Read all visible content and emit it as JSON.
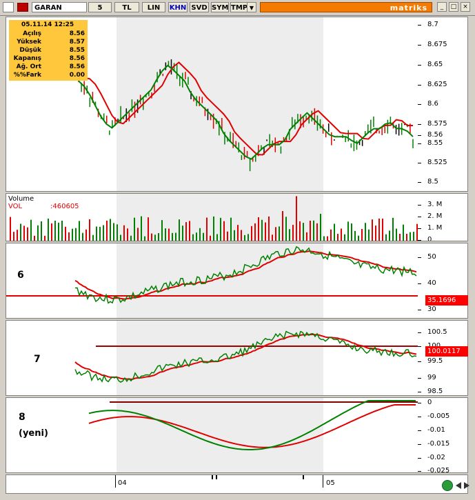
{
  "toolbar": {
    "symbol": "GARAN",
    "period": "5",
    "currency": "TL",
    "scale": "LIN",
    "khn": "KHN",
    "svd": "SVD",
    "sym": "SYM",
    "tmp": "TMP",
    "dropdown": "▼",
    "brand": "matriks",
    "minimize": "_",
    "maximize": "□",
    "close": "×"
  },
  "info": {
    "date": "05.11.14 12:25",
    "rows": [
      {
        "label": "Açılış",
        "value": "8.56"
      },
      {
        "label": "Yüksek",
        "value": "8.57"
      },
      {
        "label": "Düşük",
        "value": "8.55"
      },
      {
        "label": "Kapanış",
        "value": "8.56"
      },
      {
        "label": "Ağ. Ort",
        "value": "8.56"
      },
      {
        "label": "%%Fark",
        "value": "0.00"
      }
    ]
  },
  "volume": {
    "title": "Volume",
    "label": "VOL",
    "value": ":460605"
  },
  "annotations": {
    "p6": "6",
    "p7": "7",
    "p8": "8",
    "p8sub": "(yeni)"
  },
  "badges": {
    "p6": "35.1696",
    "p7": "100.0117"
  },
  "dates": {
    "d1": "04",
    "d2": "05"
  },
  "colors": {
    "up": "#008000",
    "down": "#e00000",
    "ma": "#e00000",
    "shade": "#ededed",
    "info": "#ffc83c",
    "toolbar_orange": "#f57a00"
  },
  "chart_data": [
    {
      "type": "line",
      "title": "",
      "series": [
        {
          "name": "",
          "values": [
            8.63,
            8.62,
            8.6,
            8.58,
            8.57,
            8.58,
            8.59,
            8.6,
            8.61,
            8.62,
            8.64,
            8.65,
            8.64,
            8.63,
            8.61,
            8.6,
            8.59,
            8.58,
            8.56,
            8.55,
            8.54,
            8.53,
            8.54,
            8.55,
            8.55,
            8.55,
            8.57,
            8.58,
            8.59,
            8.58,
            8.57,
            8.56,
            8.56,
            8.56,
            8.55,
            8.56,
            8.57,
            8.57,
            8.58,
            8.57,
            8.57,
            8.56
          ]
        }
      ],
      "ylim": [
        8.49,
        8.71
      ],
      "yticks": [
        8.7,
        8.675,
        8.65,
        8.625,
        8.6,
        8.575,
        8.56,
        8.55,
        8.525,
        8.5
      ]
    },
    {
      "type": "bar",
      "title": "",
      "yticks": [
        "3. M",
        "2. M",
        "1. M",
        "0"
      ]
    },
    {
      "type": "line",
      "title": "",
      "yticks": [
        50,
        40,
        30
      ],
      "hline": 35.1696
    },
    {
      "type": "line",
      "title": "",
      "yticks": [
        100.5,
        100,
        99.5,
        99,
        98.5
      ],
      "hline": 100.0117
    },
    {
      "type": "line",
      "title": "",
      "yticks": [
        0,
        -0.005,
        -0.01,
        -0.015,
        -0.02,
        -0.025
      ],
      "hline": 0
    }
  ]
}
